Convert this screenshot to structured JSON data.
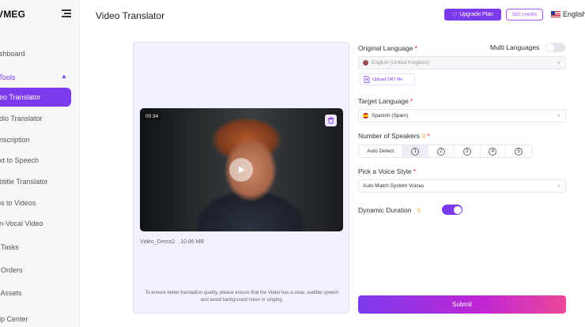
{
  "app": {
    "logo": "VMEG"
  },
  "sidebar": {
    "items": [
      {
        "label": "ashboard"
      },
      {
        "label": "l Tools"
      },
      {
        "label": "deo Translator"
      },
      {
        "label": "udio Translator"
      },
      {
        "label": "anscription"
      },
      {
        "label": "ext to Speech"
      },
      {
        "label": "ubtitle Translator"
      },
      {
        "label": "ips to Videos"
      },
      {
        "label": "on-Vocal Video"
      },
      {
        "label": "y Tasks"
      },
      {
        "label": "y Orders"
      },
      {
        "label": "y Assets"
      },
      {
        "label": "elp Center"
      }
    ]
  },
  "header": {
    "title": "Video Translator",
    "upgrade_label": "Upgrade Plan",
    "credits_label": "360 credits",
    "language_label": "English"
  },
  "video": {
    "timecode": "00:34",
    "file_name": "Video_Demo2",
    "file_size": "10.86 MB",
    "hint": "To ensure better translation quality, please ensure that the Video has a clear, audible speech and avoid background noise or singing."
  },
  "form": {
    "original_language_label": "Original Language",
    "multi_languages_label": "Multi Languages",
    "multi_languages_on": false,
    "original_language_value": "English (United Kingdom)",
    "upload_srt_label": "Upload SRT file",
    "target_language_label": "Target Language",
    "target_language_value": "Spanish (Spain)",
    "speakers_label": "Number of Speakers",
    "speakers_auto": "Auto Detect",
    "speakers_options": [
      "1",
      "2",
      "3",
      "4",
      "5"
    ],
    "speakers_selected": "1",
    "voice_style_label": "Pick a Voice Style",
    "voice_style_value": "Auto Match System Voices",
    "dynamic_duration_label": "Dynamic Duration",
    "dynamic_duration_on": true,
    "required_mark": "*",
    "submit_label": "Submit"
  },
  "colors": {
    "accent": "#7c3aed",
    "pink": "#ec4899",
    "required": "#e11d48"
  }
}
